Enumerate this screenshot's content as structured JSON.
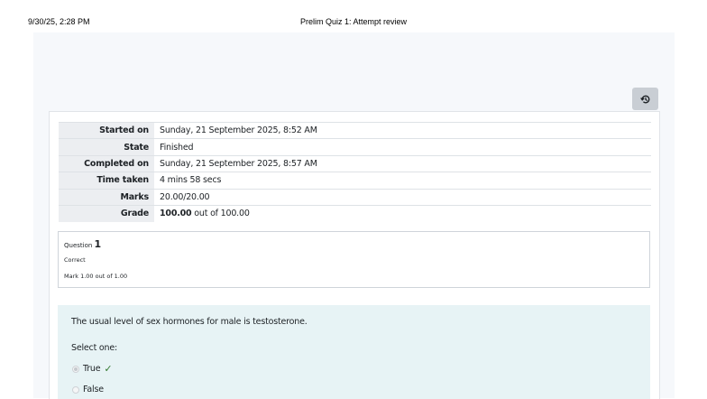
{
  "print_header": {
    "datetime": "9/30/25, 2:28 PM",
    "title": "Prelim Quiz 1: Attempt review"
  },
  "toolbar": {
    "history_icon": "history-icon"
  },
  "summary": {
    "rows": [
      {
        "label": "Started on",
        "value": "Sunday, 21 September 2025, 8:52 AM"
      },
      {
        "label": "State",
        "value": "Finished"
      },
      {
        "label": "Completed on",
        "value": "Sunday, 21 September 2025, 8:57 AM"
      },
      {
        "label": "Time taken",
        "value": "4 mins 58 secs"
      },
      {
        "label": "Marks",
        "value": "20.00/20.00"
      },
      {
        "label": "Grade",
        "value_bold": "100.00",
        "value_rest": " out of 100.00"
      }
    ]
  },
  "question": {
    "prefix": "Question",
    "number": "1",
    "state": "Correct",
    "mark": "Mark 1.00 out of 1.00",
    "text": "The usual level of sex hormones for male is testosterone.",
    "prompt": "Select one:",
    "options": [
      {
        "label": "True",
        "selected": true,
        "correct_mark": "✓"
      },
      {
        "label": "False",
        "selected": false
      }
    ]
  },
  "colors": {
    "page_bg": "#f6f8fb",
    "question_text_bg": "#e7f3f5",
    "correct_check": "#357a32"
  }
}
